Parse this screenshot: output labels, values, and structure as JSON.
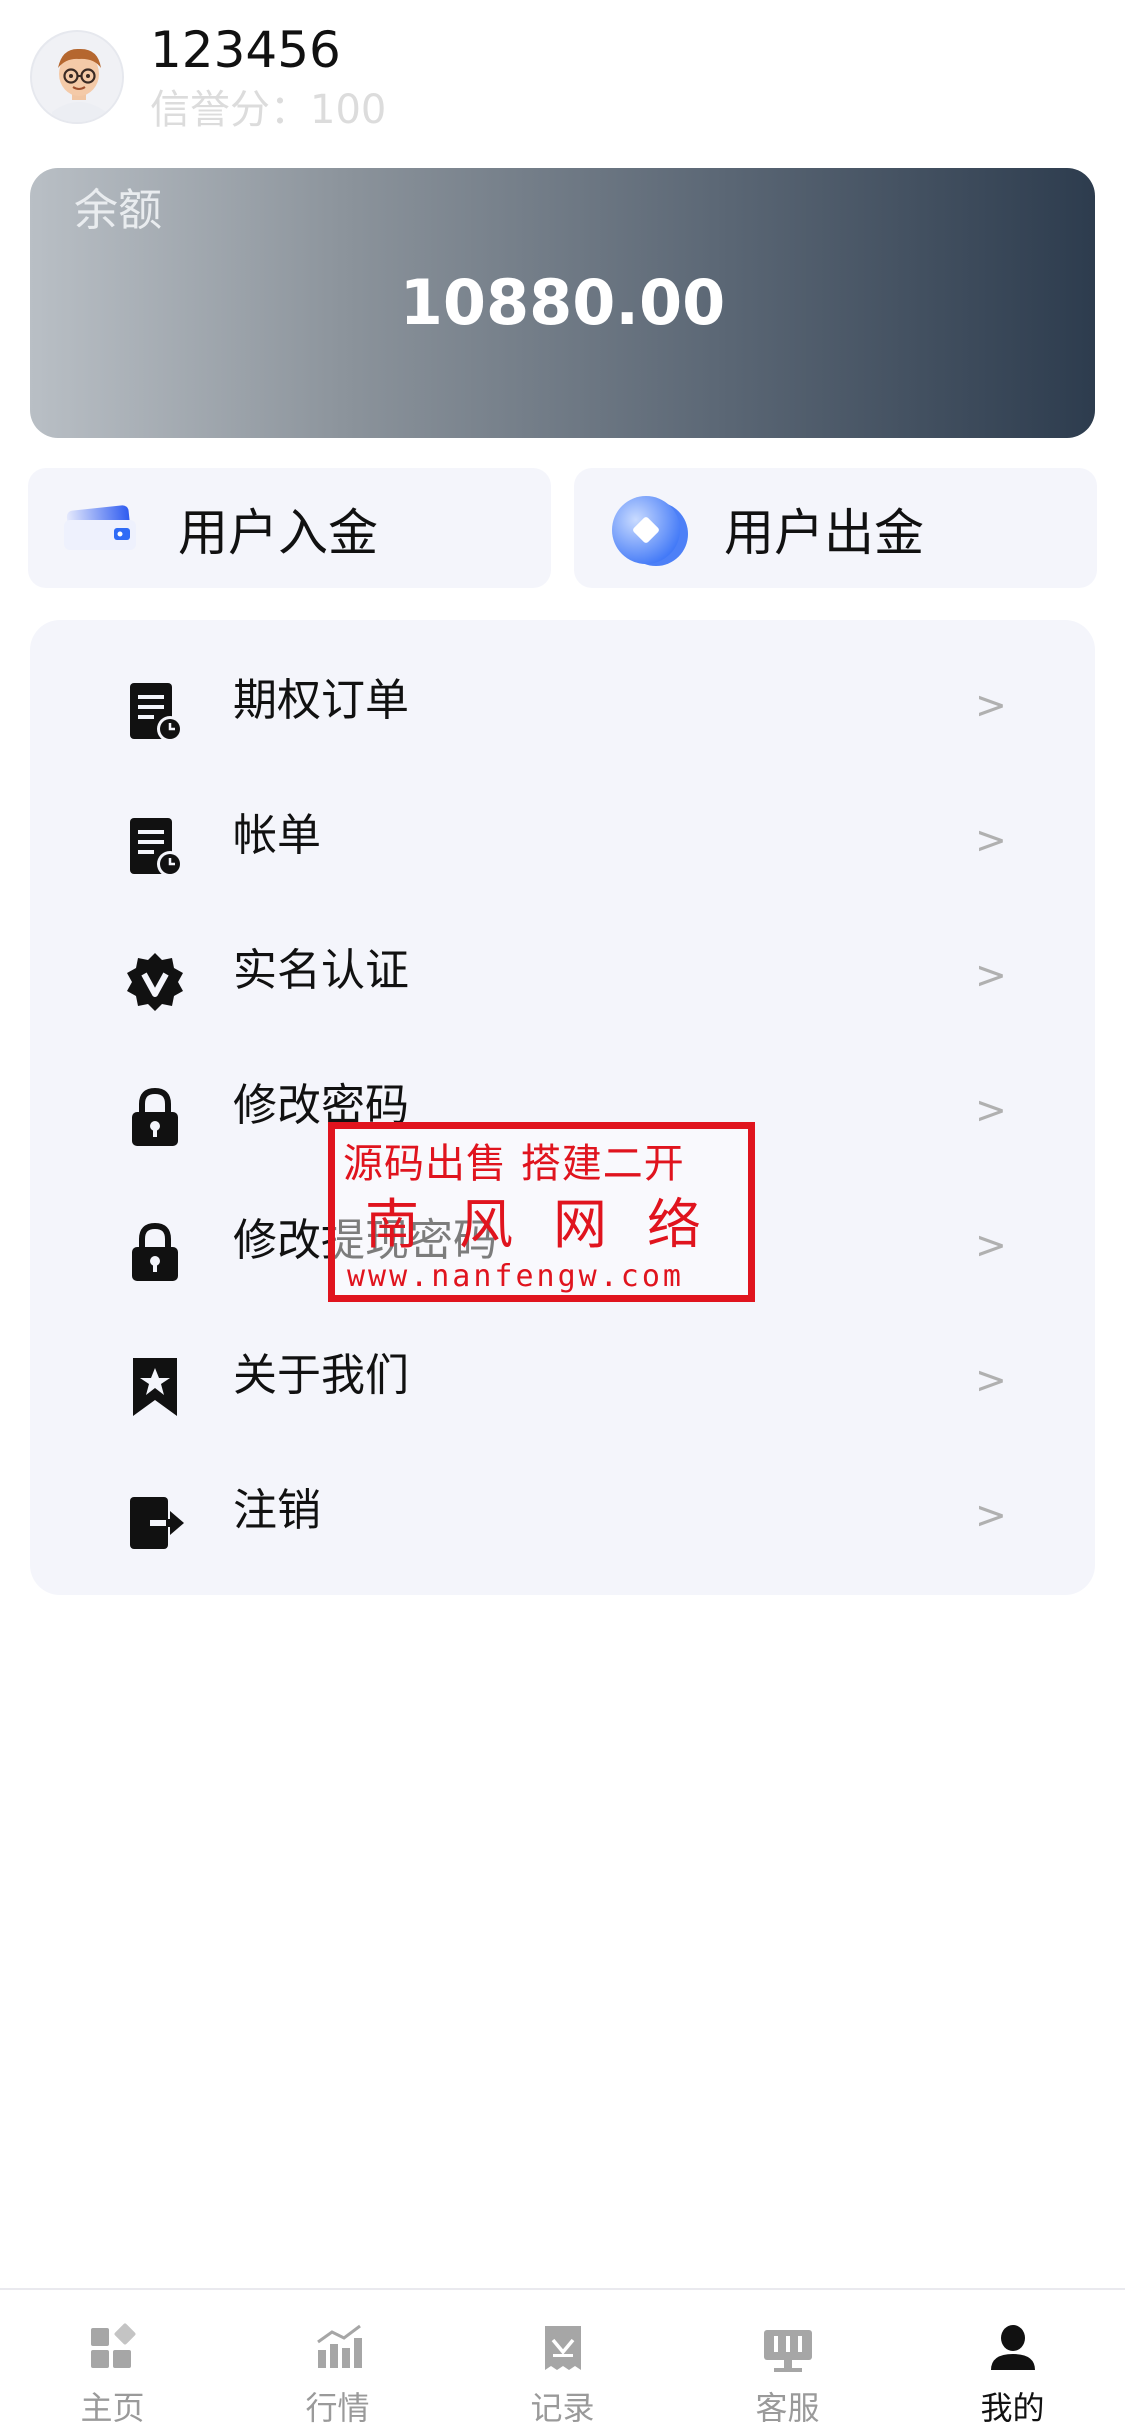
{
  "header": {
    "username": "123456",
    "credit_text": "信誉分：100"
  },
  "balance": {
    "label": "余额",
    "value": "10880.00"
  },
  "actions": [
    {
      "label": "用户入金",
      "icon": "wallet-icon"
    },
    {
      "label": "用户出金",
      "icon": "coin-icon"
    }
  ],
  "menu": [
    {
      "label": "期权订单",
      "icon": "document-clock-icon",
      "chevron": ">"
    },
    {
      "label": "帐单",
      "icon": "document-clock-icon",
      "chevron": ">"
    },
    {
      "label": "实名认证",
      "icon": "verified-badge-icon",
      "chevron": ">"
    },
    {
      "label": "修改密码",
      "icon": "lock-icon",
      "chevron": ">"
    },
    {
      "label": "修改提现密码",
      "icon": "lock-icon",
      "chevron": ">"
    },
    {
      "label": "关于我们",
      "icon": "bookmark-star-icon",
      "chevron": ">"
    },
    {
      "label": "注销",
      "icon": "logout-icon",
      "chevron": ">"
    }
  ],
  "watermark": {
    "line1": "源码出售 搭建二开",
    "line2": "南风网络",
    "line3": "www.nanfengw.com"
  },
  "tabs": [
    {
      "label": "主页",
      "icon": "dashboard-icon",
      "active": false
    },
    {
      "label": "行情",
      "icon": "chart-icon",
      "active": false
    },
    {
      "label": "记录",
      "icon": "receipt-icon",
      "active": false
    },
    {
      "label": "客服",
      "icon": "support-icon",
      "active": false
    },
    {
      "label": "我的",
      "icon": "user-icon",
      "active": true
    }
  ],
  "colors": {
    "watermark_red": "#e0141e",
    "accent_blue": "#2f6bf6",
    "inactive_tab": "#9a9a9a"
  }
}
